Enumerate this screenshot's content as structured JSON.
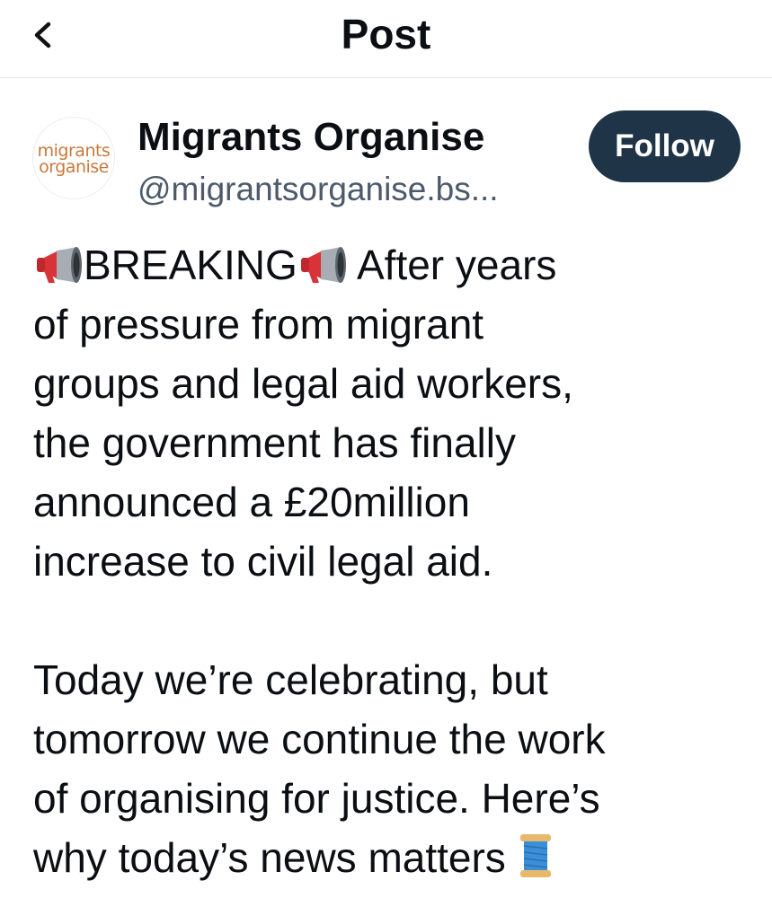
{
  "header": {
    "title": "Post",
    "back_icon": "chevron-left-icon"
  },
  "author": {
    "avatar_text_line1": "migrants",
    "avatar_text_line2": "organise",
    "display_name": "Migrants Organise",
    "handle": "@migrantsorganise.bs...",
    "follow_label": "Follow"
  },
  "post": {
    "breaking_word": "BREAKING",
    "line1_rest": " After years",
    "line2": "of pressure from migrant",
    "line3": "groups and legal aid workers,",
    "line4": "the government has finally",
    "line5": "announced a £20million",
    "line6": "increase to civil legal aid.",
    "line7": "Today we’re celebrating, but",
    "line8": "tomorrow we continue the work",
    "line9": "of organising for justice. Here’s",
    "line10": "why today’s news matters",
    "emojis": [
      "megaphone-emoji",
      "megaphone-emoji",
      "thread-spool-emoji"
    ]
  },
  "colors": {
    "follow_bg": "#1f3446",
    "handle_text": "#4c5a6a",
    "avatar_text": "#c9793a"
  }
}
